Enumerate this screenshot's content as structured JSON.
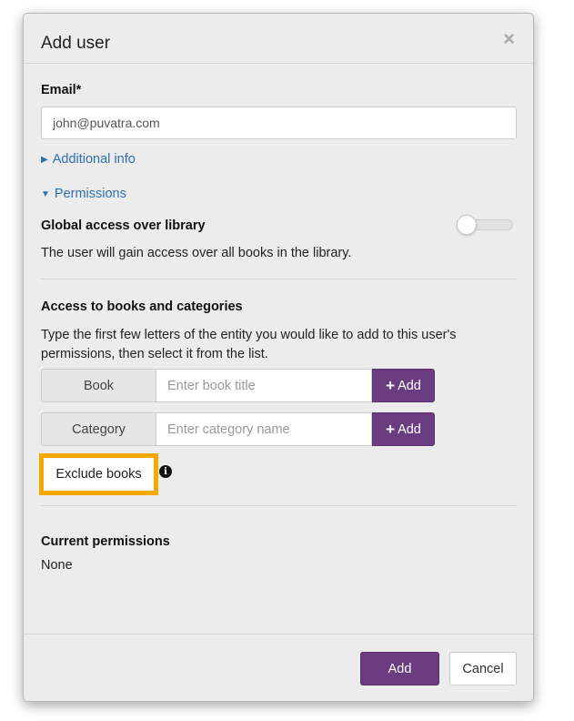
{
  "modal": {
    "title": "Add user",
    "close_glyph": "×"
  },
  "email": {
    "label": "Email*",
    "value": "john@puvatra.com"
  },
  "sections": {
    "additional_info": "Additional info",
    "permissions": "Permissions"
  },
  "global_access": {
    "title": "Global access over library",
    "description": "The user will gain access over all books in the library.",
    "enabled": false
  },
  "access": {
    "title": "Access to books and categories",
    "description": "Type the first few letters of the entity you would like to add to this user's permissions, then select it from the list.",
    "book": {
      "label": "Book",
      "placeholder": "Enter book title",
      "button": "Add"
    },
    "category": {
      "label": "Category",
      "placeholder": "Enter category name",
      "button": "Add"
    },
    "exclude_button": "Exclude books"
  },
  "current_permissions": {
    "title": "Current permissions",
    "value": "None"
  },
  "footer": {
    "add_label": "Add",
    "cancel_label": "Cancel"
  },
  "colors": {
    "primary": "#6b3d80",
    "link": "#2f6fb0",
    "highlight": "#f7a800"
  },
  "icons": {
    "close": "close-icon",
    "collapsed": "caret-right-icon",
    "expanded": "caret-down-icon",
    "plus": "plus-icon",
    "info": "info-icon"
  }
}
